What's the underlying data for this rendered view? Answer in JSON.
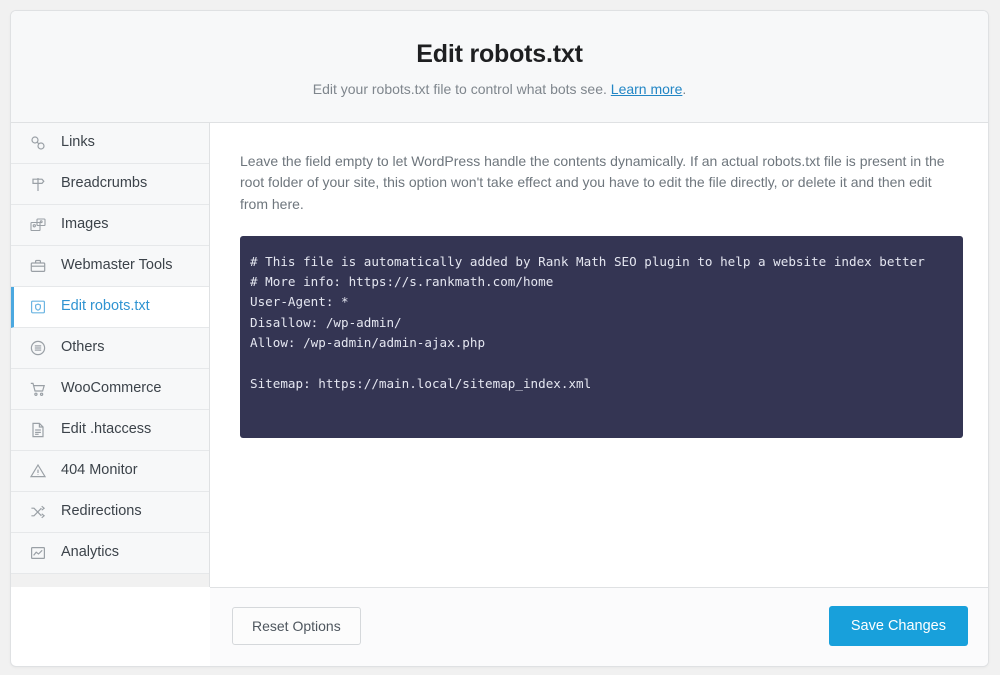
{
  "header": {
    "title": "Edit robots.txt",
    "subtitle_before": "Edit your robots.txt file to control what bots see. ",
    "link_label": "Learn more",
    "subtitle_after": "."
  },
  "sidebar": {
    "items": [
      {
        "label": "Links",
        "icon": "link-icon",
        "active": false
      },
      {
        "label": "Breadcrumbs",
        "icon": "signpost-icon",
        "active": false
      },
      {
        "label": "Images",
        "icon": "images-icon",
        "active": false
      },
      {
        "label": "Webmaster Tools",
        "icon": "briefcase-icon",
        "active": false
      },
      {
        "label": "Edit robots.txt",
        "icon": "robots-shield-icon",
        "active": true
      },
      {
        "label": "Others",
        "icon": "menu-circle-icon",
        "active": false
      },
      {
        "label": "WooCommerce",
        "icon": "cart-icon",
        "active": false
      },
      {
        "label": "Edit .htaccess",
        "icon": "document-icon",
        "active": false
      },
      {
        "label": "404 Monitor",
        "icon": "warning-triangle-icon",
        "active": false
      },
      {
        "label": "Redirections",
        "icon": "shuffle-icon",
        "active": false
      },
      {
        "label": "Analytics",
        "icon": "chart-icon",
        "active": false
      }
    ]
  },
  "main": {
    "help_text": "Leave the field empty to let WordPress handle the contents dynamically. If an actual robots.txt file is present in the root folder of your site, this option won't take effect and you have to edit the file directly, or delete it and then edit from here.",
    "editor_value": "# This file is automatically added by Rank Math SEO plugin to help a website index better\n# More info: https://s.rankmath.com/home\nUser-Agent: *\nDisallow: /wp-admin/\nAllow: /wp-admin/admin-ajax.php\n\nSitemap: https://main.local/sitemap_index.xml",
    "editor_placeholder": ""
  },
  "footer": {
    "reset_label": "Reset Options",
    "save_label": "Save Changes"
  },
  "colors": {
    "accent_blue": "#18a0db",
    "active_blue": "#2f93d1",
    "active_border": "#4ba8e0",
    "editor_bg": "#343553",
    "editor_text": "#e4e6f0",
    "link": "#2286c5",
    "panel_bg": "#f7f8f9",
    "page_bg": "#f1f1f1",
    "border": "#dfe1e3"
  }
}
